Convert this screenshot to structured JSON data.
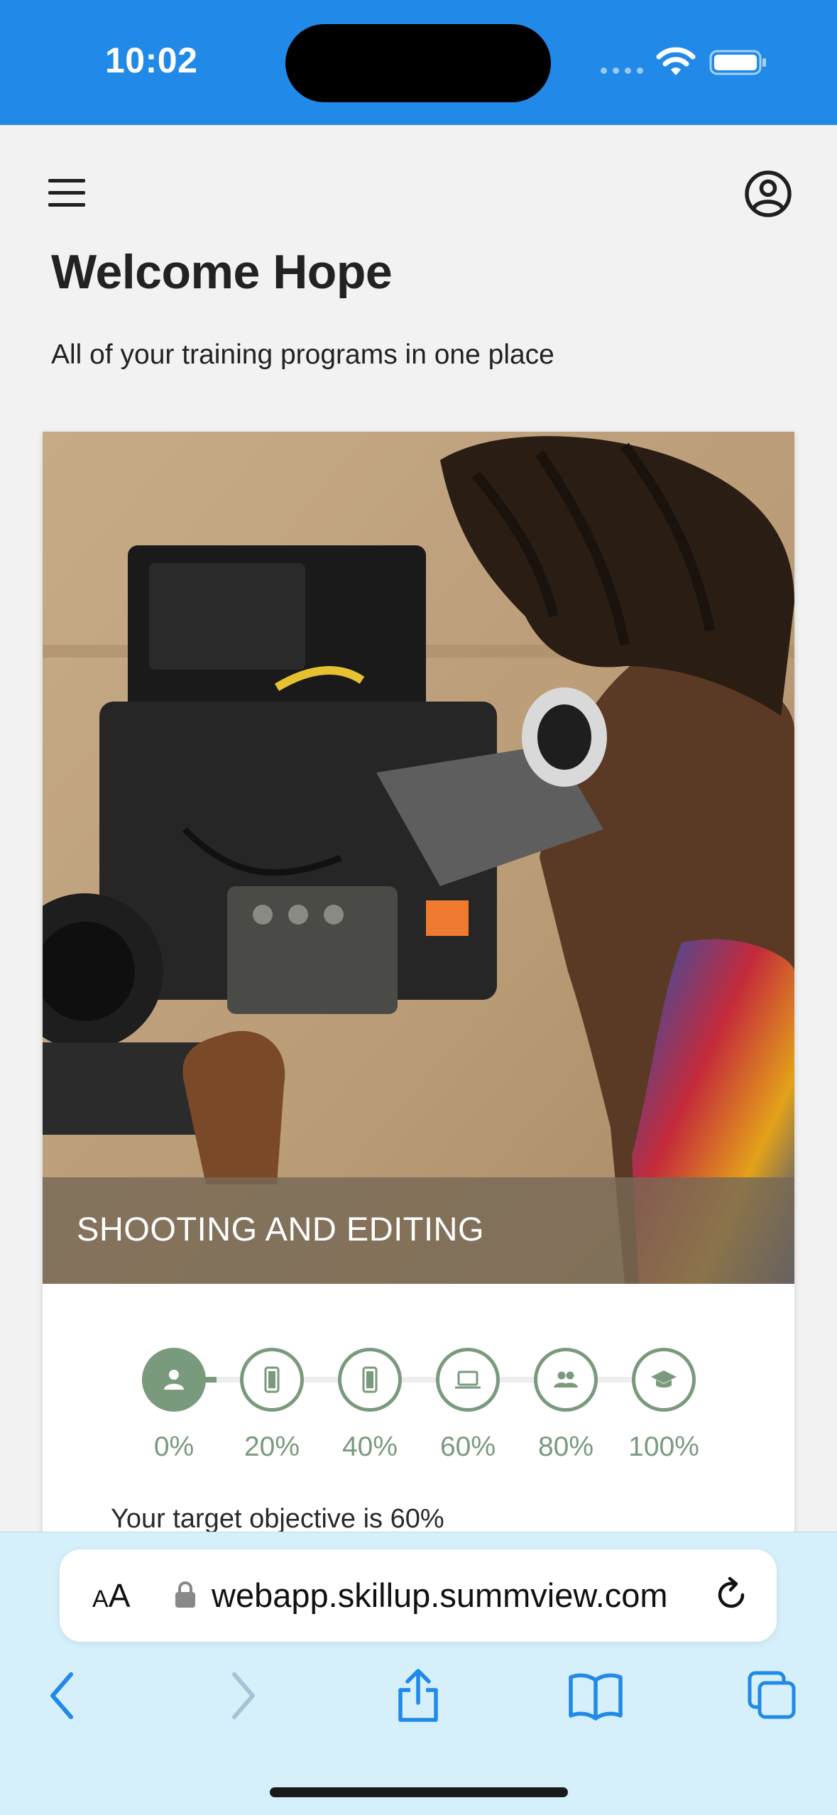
{
  "status_bar": {
    "time": "10:02"
  },
  "header": {
    "menu_icon": "hamburger-menu-icon",
    "account_icon": "account-circle-icon",
    "title": "Welcome Hope",
    "subtitle": "All of your training programs in one place"
  },
  "program_card": {
    "title": "SHOOTING AND EDITING",
    "image": "photo of a man looking through a cinema camera viewfinder",
    "progress_steps": [
      {
        "label": "0%",
        "icon": "person-icon"
      },
      {
        "label": "20%",
        "icon": "smartphone-icon"
      },
      {
        "label": "40%",
        "icon": "smartphone-icon"
      },
      {
        "label": "60%",
        "icon": "laptop-icon"
      },
      {
        "label": "80%",
        "icon": "group-icon"
      },
      {
        "label": "100%",
        "icon": "graduation-cap-icon"
      }
    ],
    "current_progress": 0,
    "objective_text": "Your target objective is 60%",
    "accent_color": "#7a9a7e"
  },
  "browser": {
    "text_size_label": "AA",
    "url": "webapp.skillup.summview.com",
    "accent_color": "#2189e8"
  }
}
